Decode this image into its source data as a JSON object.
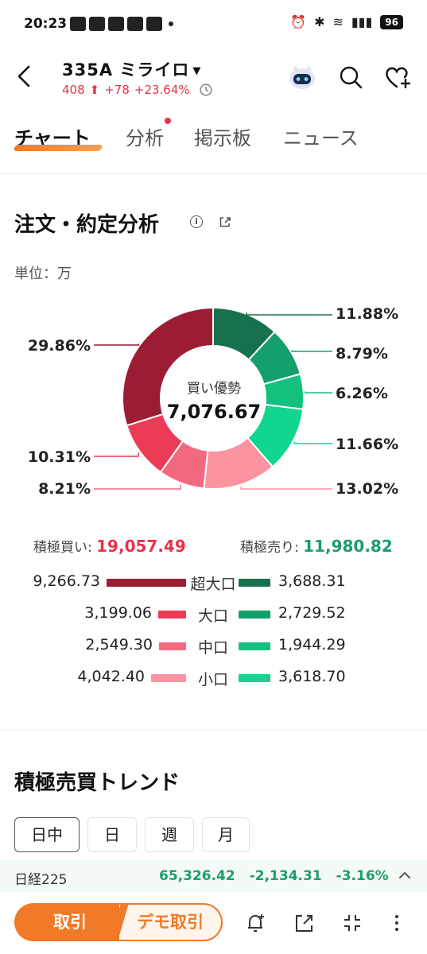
{
  "status_bar": {
    "time": "20:23",
    "battery": "96"
  },
  "header": {
    "title": "335A ミライロ",
    "price": "408",
    "change": "+78",
    "change_pct": "+23.64%"
  },
  "tabs": [
    {
      "label": "チャート",
      "active": true
    },
    {
      "label": "分析",
      "active": false
    },
    {
      "label": "掲示板",
      "active": false
    },
    {
      "label": "ニュース",
      "active": false
    }
  ],
  "order_analysis": {
    "title": "注文・約定分析",
    "unit": "単位：万",
    "center_label": "買い優勢",
    "center_value": "7,076.67",
    "total_buy_label": "積極買い:",
    "total_buy_value": "19,057.49",
    "total_sell_label": "積極売り:",
    "total_sell_value": "11,980.82"
  },
  "chart_data": {
    "type": "pie",
    "segments": [
      {
        "side": "sell",
        "size": "超大口",
        "pct_label": "11.88%",
        "value": 11.88,
        "color": "#17714f"
      },
      {
        "side": "sell",
        "size": "大口",
        "pct_label": "8.79%",
        "value": 8.79,
        "color": "#13a06a"
      },
      {
        "side": "sell",
        "size": "中口",
        "pct_label": "6.26%",
        "value": 6.26,
        "color": "#14c07e"
      },
      {
        "side": "sell",
        "size": "小口",
        "pct_label": "11.66%",
        "value": 11.66,
        "color": "#10d68e"
      },
      {
        "side": "buy",
        "size": "小口",
        "pct_label": "13.02%",
        "value": 13.02,
        "color": "#fb93a1"
      },
      {
        "side": "buy",
        "size": "中口",
        "pct_label": "8.21%",
        "value": 8.21,
        "color": "#f36a80"
      },
      {
        "side": "buy",
        "size": "大口",
        "pct_label": "10.31%",
        "value": 10.31,
        "color": "#ec3b57"
      },
      {
        "side": "buy",
        "size": "超大口",
        "pct_label": "29.86%",
        "value": 29.86,
        "color": "#9c1d33"
      }
    ]
  },
  "breakdown": [
    {
      "label": "超大口",
      "buy": "9,266.73",
      "buy_value": 9266.73,
      "sell": "3,688.31",
      "sell_value": 3688.31,
      "buy_color": "#9c1d33",
      "sell_color": "#17714f"
    },
    {
      "label": "大口",
      "buy": "3,199.06",
      "buy_value": 3199.06,
      "sell": "2,729.52",
      "sell_value": 2729.52,
      "buy_color": "#ec3b57",
      "sell_color": "#13a06a"
    },
    {
      "label": "中口",
      "buy": "2,549.30",
      "buy_value": 2549.3,
      "sell": "1,944.29",
      "sell_value": 1944.29,
      "buy_color": "#f36a80",
      "sell_color": "#14c07e"
    },
    {
      "label": "小口",
      "buy": "4,042.40",
      "buy_value": 4042.4,
      "sell": "3,618.70",
      "sell_value": 3618.7,
      "buy_color": "#fb93a1",
      "sell_color": "#10d68e"
    }
  ],
  "trend": {
    "title": "積極売買トレンド",
    "periods": [
      {
        "label": "日中",
        "active": true
      },
      {
        "label": "日",
        "active": false
      },
      {
        "label": "週",
        "active": false
      },
      {
        "label": "月",
        "active": false
      }
    ]
  },
  "index_bar": {
    "name": "日経225",
    "value": "65,326.42",
    "change": "-2,134.31",
    "change_pct": "-3.16%"
  },
  "bottom_bar": {
    "trade_label": "取引",
    "demo_label": "デモ取引"
  }
}
